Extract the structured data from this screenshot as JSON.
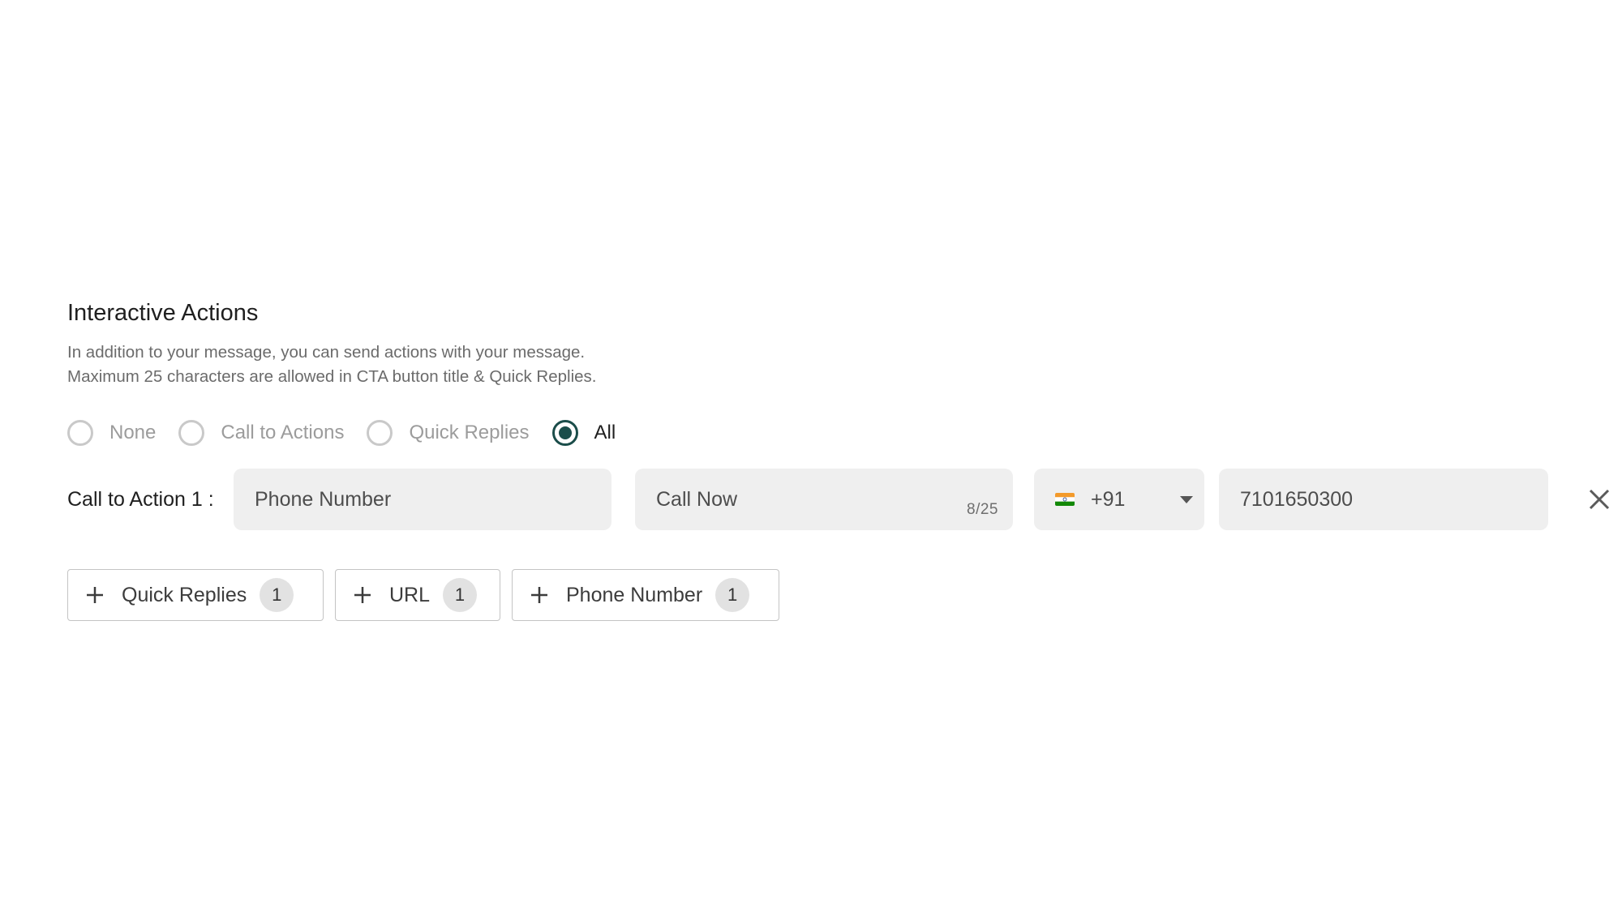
{
  "section": {
    "title": "Interactive Actions",
    "description_line1": "In addition to your message, you can send actions with your message.",
    "description_line2": "Maximum 25 characters are allowed in CTA button title & Quick Replies."
  },
  "action_type": {
    "options": [
      {
        "label": "None",
        "selected": false
      },
      {
        "label": "Call to Actions",
        "selected": false
      },
      {
        "label": "Quick Replies",
        "selected": false
      },
      {
        "label": "All",
        "selected": true
      }
    ]
  },
  "cta": {
    "label": "Call to Action 1 :",
    "type_value": "Phone Number",
    "button_title_value": "Call Now",
    "button_title_counter": "8/25",
    "country_code": "+91",
    "country_flag_icon": "india-flag-icon",
    "phone_value": "7101650300",
    "remove_icon": "close-icon"
  },
  "add_buttons": [
    {
      "label": "Quick Replies",
      "count": "1",
      "icon": "plus-icon"
    },
    {
      "label": "URL",
      "count": "1",
      "icon": "plus-icon"
    },
    {
      "label": "Phone Number",
      "count": "1",
      "icon": "plus-icon"
    }
  ],
  "colors": {
    "accent": "#1b4d4a",
    "field_bg": "#efefef",
    "badge_bg": "#e2e2e2"
  }
}
